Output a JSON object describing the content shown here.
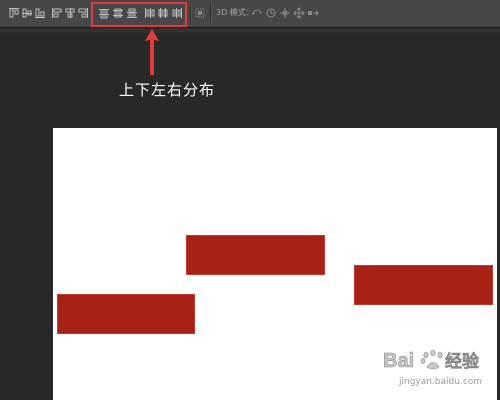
{
  "toolbar": {
    "align_group": [
      {
        "name": "align-top-edges-icon"
      },
      {
        "name": "align-vertical-centers-icon"
      },
      {
        "name": "align-bottom-edges-icon"
      },
      {
        "name": "align-left-edges-icon"
      },
      {
        "name": "align-horizontal-centers-icon"
      },
      {
        "name": "align-right-edges-icon"
      }
    ],
    "distribute_group": [
      {
        "name": "distribute-top-icon"
      },
      {
        "name": "distribute-vertical-centers-icon"
      },
      {
        "name": "distribute-bottom-icon"
      },
      {
        "name": "distribute-left-icon"
      },
      {
        "name": "distribute-horizontal-centers-icon"
      },
      {
        "name": "distribute-right-icon"
      }
    ],
    "auto_align_icon": "auto-align-layers-icon",
    "mode_label": "3D 模式：",
    "mode_icons": [
      "rotate-3d-icon",
      "roll-3d-icon",
      "pan-3d-icon",
      "slide-3d-icon",
      "scale-3d-icon"
    ]
  },
  "annotation": {
    "text": "上下左右分布",
    "color": "#ffffff",
    "highlight_color": "#e23b3b"
  },
  "canvas": {
    "background": "#ffffff",
    "shape_color": "#a82115",
    "shapes": [
      "red-rectangle-left",
      "red-rectangle-middle",
      "red-rectangle-right"
    ]
  },
  "watermark": {
    "logo": "Bai 经验",
    "url": "jingyan.baidu.com"
  }
}
